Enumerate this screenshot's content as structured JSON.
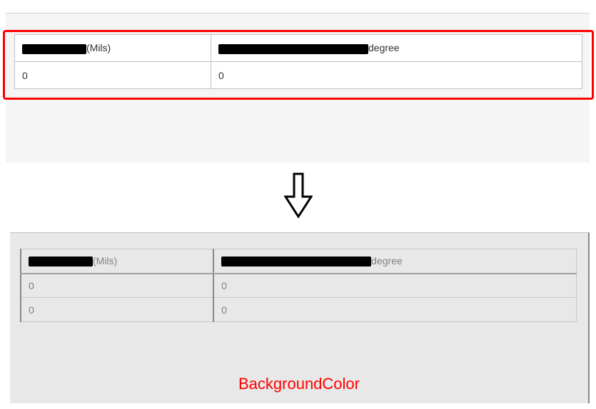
{
  "top_table": {
    "header": {
      "col1_suffix": "(Mils)",
      "col2_suffix": "degree"
    },
    "rows": [
      {
        "col1": "0",
        "col2": "0"
      }
    ]
  },
  "bottom_table": {
    "header": {
      "col1_suffix": "(Mils)",
      "col2_suffix": "degree"
    },
    "rows": [
      {
        "col1": "0",
        "col2": "0"
      },
      {
        "col1": "0",
        "col2": "0"
      }
    ]
  },
  "caption": "BackgroundColor"
}
